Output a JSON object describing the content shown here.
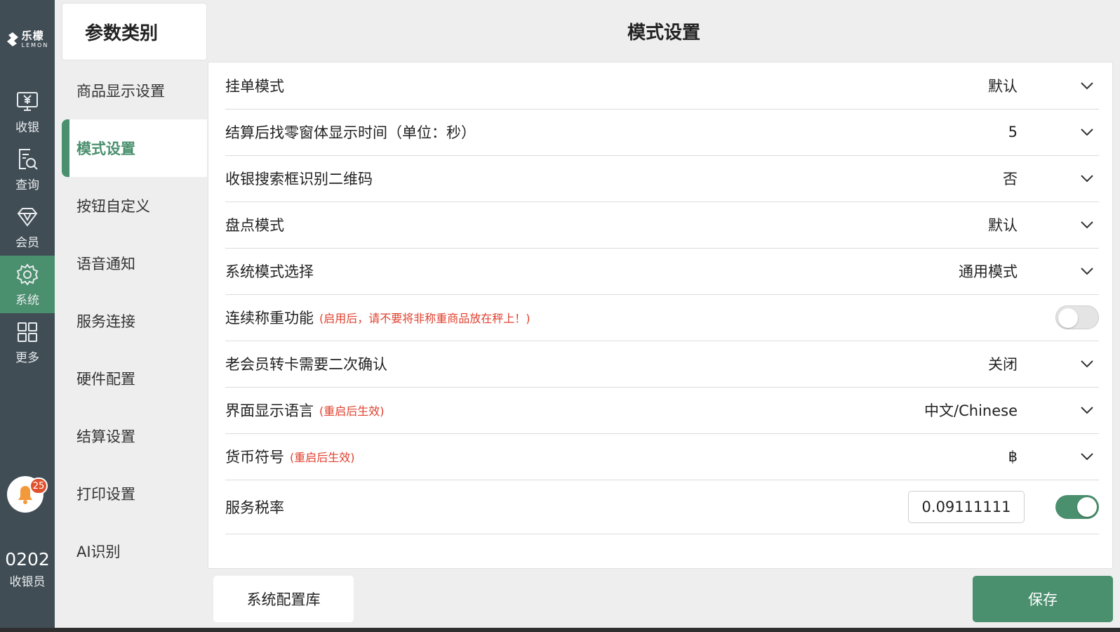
{
  "app": {
    "logo_cn": "乐檬",
    "logo_en": "LEMON"
  },
  "nav": {
    "items": [
      {
        "label": "收银",
        "icon": "cashier-yen-icon"
      },
      {
        "label": "查询",
        "icon": "search-document-icon"
      },
      {
        "label": "会员",
        "icon": "diamond-icon"
      },
      {
        "label": "系统",
        "icon": "gear-icon",
        "active": true
      },
      {
        "label": "更多",
        "icon": "grid-icon"
      }
    ],
    "notification_count": "25",
    "user_id": "0202",
    "user_role": "收银员"
  },
  "categories": {
    "header": "参数类别",
    "items": [
      {
        "label": "商品显示设置"
      },
      {
        "label": "模式设置",
        "active": true
      },
      {
        "label": "按钮自定义"
      },
      {
        "label": "语音通知"
      },
      {
        "label": "服务连接"
      },
      {
        "label": "硬件配置"
      },
      {
        "label": "结算设置"
      },
      {
        "label": "打印设置"
      },
      {
        "label": "AI识别"
      }
    ]
  },
  "main": {
    "title": "模式设置",
    "settings": [
      {
        "label": "挂单模式",
        "note": "",
        "value": "默认"
      },
      {
        "label": "结算后找零窗体显示时间（单位：秒）",
        "note": "",
        "value": "5"
      },
      {
        "label": "收银搜索框识别二维码",
        "note": "",
        "value": "否"
      },
      {
        "label": "盘点模式",
        "note": "",
        "value": "默认"
      },
      {
        "label": "系统模式选择",
        "note": "",
        "value": "通用模式"
      },
      {
        "label": "连续称重功能",
        "note": "(启用后，请不要将非称重商品放在秤上！)",
        "toggle": false
      },
      {
        "label": "老会员转卡需要二次确认",
        "note": "",
        "value": "关闭"
      },
      {
        "label": "界面显示语言",
        "note": "(重启后生效)",
        "value": "中文/Chinese"
      },
      {
        "label": "货币符号",
        "note": "(重启后生效)",
        "value": "฿"
      },
      {
        "label": "服务税率",
        "note": "",
        "input_value": "0.09111111",
        "toggle": true
      }
    ]
  },
  "buttons": {
    "config_library": "系统配置库",
    "save": "保存"
  },
  "colors": {
    "accent": "#4a8f6e",
    "rail": "#414d55",
    "note_red": "#e0402f",
    "badge": "#e0522d"
  }
}
